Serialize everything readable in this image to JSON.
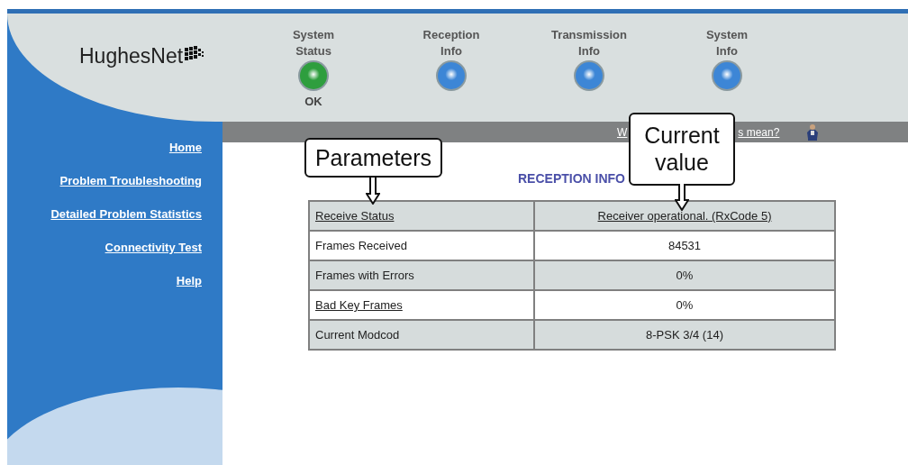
{
  "logo": {
    "text": "HughesNet"
  },
  "indicators": [
    {
      "label": "System\nStatus",
      "color": "#2e9e3e",
      "status": "OK"
    },
    {
      "label": "Reception\nInfo",
      "color": "#3d86d6"
    },
    {
      "label": "Transmission\nInfo",
      "color": "#3d86d6"
    },
    {
      "label": "System\nInfo",
      "color": "#3d86d6"
    }
  ],
  "sidebar": {
    "items": [
      "Home",
      "Problem Troubleshooting",
      "Detailed Problem Statistics",
      "Connectivity Test",
      "Help"
    ]
  },
  "help_link": {
    "start": "W",
    "end": "s mean?"
  },
  "title": "RECEPTION INFO",
  "table": {
    "rows": [
      {
        "parameter": "Receive Status",
        "value": "Receiver operational. (RxCode 5)",
        "link": true,
        "value_link": true
      },
      {
        "parameter": "Frames Received",
        "value": "84531",
        "link": false,
        "value_link": false
      },
      {
        "parameter": "Frames with Errors",
        "value": "0%",
        "link": false,
        "value_link": false
      },
      {
        "parameter": "Bad Key Frames",
        "value": "0%",
        "link": true,
        "value_link": false
      },
      {
        "parameter": "Current Modcod",
        "value": "8-PSK 3/4 (14)",
        "link": false,
        "value_link": false
      }
    ]
  },
  "callouts": [
    {
      "text": "Parameters",
      "kind": "parameters"
    },
    {
      "text": "Current\nvalue",
      "kind": "value"
    }
  ]
}
